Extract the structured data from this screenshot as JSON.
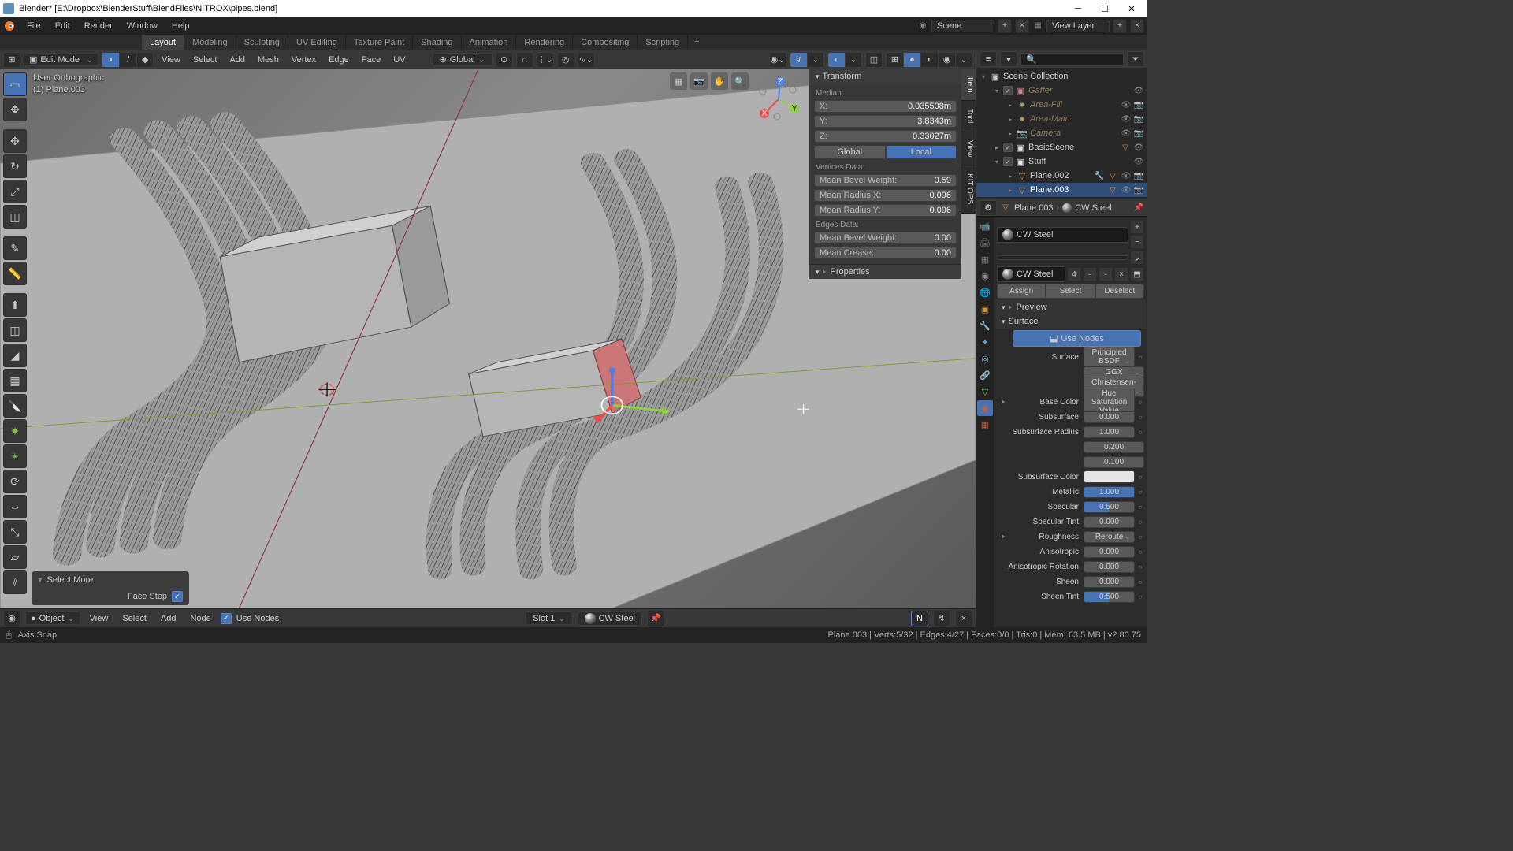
{
  "title": "Blender* [E:\\Dropbox\\BlenderStuff\\BlendFiles\\NITROX\\pipes.blend]",
  "menubar": {
    "items": [
      "File",
      "Edit",
      "Render",
      "Window",
      "Help"
    ]
  },
  "topbar": {
    "scene_label": "Scene",
    "viewlayer_label": "View Layer"
  },
  "workspaces": {
    "tabs": [
      "Layout",
      "Modeling",
      "Sculpting",
      "UV Editing",
      "Texture Paint",
      "Shading",
      "Animation",
      "Rendering",
      "Compositing",
      "Scripting"
    ],
    "active": 0
  },
  "view_header": {
    "mode": "Edit Mode",
    "menus": [
      "View",
      "Select",
      "Add",
      "Mesh",
      "Vertex",
      "Edge",
      "Face",
      "UV"
    ],
    "orientation": "Global"
  },
  "viewport": {
    "label": "User Orthographic",
    "obj": "(1) Plane.003"
  },
  "n_panel": {
    "tabs": [
      "Item",
      "Tool",
      "View",
      "KIT OPS"
    ],
    "transform_header": "Transform",
    "median_label": "Median:",
    "x": "0.035508m",
    "y": "3.8343m",
    "z": "0.33027m",
    "global": "Global",
    "local": "Local",
    "verts_label": "Vertices Data:",
    "bevel_weight_label": "Mean Bevel Weight:",
    "bevel_weight": "0.59",
    "radius_x_label": "Mean Radius X:",
    "radius_x": "0.096",
    "radius_y_label": "Mean Radius Y:",
    "radius_y": "0.096",
    "edges_label": "Edges Data:",
    "e_bevel_label": "Mean Bevel Weight:",
    "e_bevel": "0.00",
    "crease_label": "Mean Crease:",
    "crease": "0.00",
    "properties_header": "Properties"
  },
  "redo": {
    "title": "Select More",
    "face_step_label": "Face Step"
  },
  "bottom": {
    "object": "Object",
    "view": "View",
    "select": "Select",
    "add": "Add",
    "node": "Node",
    "use_nodes": "Use Nodes",
    "slot": "Slot 1",
    "mat": "CW Steel"
  },
  "status": {
    "left": "Axis Snap",
    "right": "Plane.003 | Verts:5/32 | Edges:4/27 | Faces:0/0 | Tris:0 | Mem: 63.5 MB | v2.80.75"
  },
  "outliner": {
    "scene": "Scene Collection",
    "gaffer": "Gaffer",
    "area_fill": "Area-Fill",
    "area_main": "Area-Main",
    "camera": "Camera",
    "basic": "BasicScene",
    "stuff": "Stuff",
    "p2": "Plane.002",
    "p3": "Plane.003"
  },
  "props": {
    "breadcrumb_obj": "Plane.003",
    "breadcrumb_mat": "CW Steel",
    "material": "CW Steel",
    "users": "4",
    "assign": "Assign",
    "select": "Select",
    "deselect": "Deselect",
    "preview": "Preview",
    "surface_header": "Surface",
    "use_nodes": "Use Nodes",
    "surface": "Surface",
    "bsdf": "Principled BSDF",
    "ggx": "GGX",
    "burley": "Christensen-Burley",
    "base_color": "Base Color",
    "hsv": "Hue Saturation Value",
    "subsurface": "Subsurface",
    "ss_val": "0.000",
    "ss_radius": "Subsurface Radius",
    "ssr1": "1.000",
    "ssr2": "0.200",
    "ssr3": "0.100",
    "ss_color": "Subsurface Color",
    "metallic": "Metallic",
    "metallic_val": "1.000",
    "specular": "Specular",
    "specular_val": "0.500",
    "spectint": "Specular Tint",
    "spectint_val": "0.000",
    "roughness": "Roughness",
    "reroute": "Reroute",
    "aniso": "Anisotropic",
    "aniso_val": "0.000",
    "aniso_rot": "Anisotropic Rotation",
    "aniso_rot_val": "0.000",
    "sheen": "Sheen",
    "sheen_val": "0.000",
    "sheen_tint": "Sheen Tint",
    "sheen_tint_val": "0.500"
  }
}
